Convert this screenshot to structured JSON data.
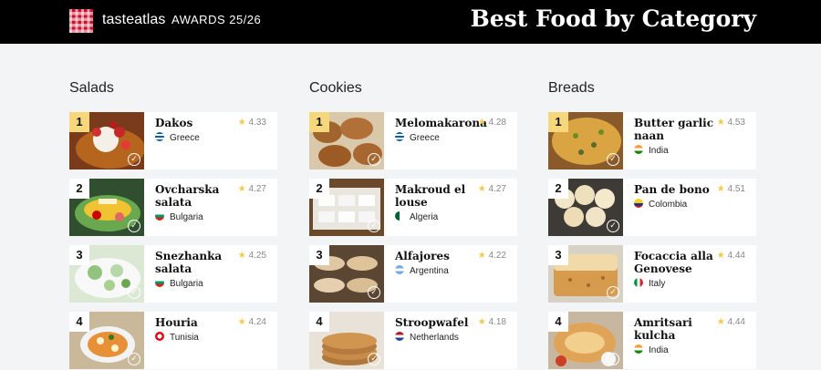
{
  "header": {
    "brand": "tasteatlas",
    "awards": "AWARDS 25/26",
    "title": "Best Food by Category"
  },
  "colors": {
    "accent_gold": "#f6d77b",
    "star": "#f2c94c",
    "header_bg": "#000000"
  },
  "columns": [
    {
      "title": "Salads",
      "items": [
        {
          "rank": "1",
          "name": "Dakos",
          "rating": "4.33",
          "country": "Greece"
        },
        {
          "rank": "2",
          "name": "Ovcharska salata",
          "rating": "4.27",
          "country": "Bulgaria"
        },
        {
          "rank": "3",
          "name": "Snezhanka salata",
          "rating": "4.25",
          "country": "Bulgaria"
        },
        {
          "rank": "4",
          "name": "Houria",
          "rating": "4.24",
          "country": "Tunisia"
        }
      ]
    },
    {
      "title": "Cookies",
      "items": [
        {
          "rank": "1",
          "name": "Melomakarona",
          "rating": "4.28",
          "country": "Greece"
        },
        {
          "rank": "2",
          "name": "Makroud el louse",
          "rating": "4.27",
          "country": "Algeria"
        },
        {
          "rank": "3",
          "name": "Alfajores",
          "rating": "4.22",
          "country": "Argentina"
        },
        {
          "rank": "4",
          "name": "Stroopwafel",
          "rating": "4.18",
          "country": "Netherlands"
        }
      ]
    },
    {
      "title": "Breads",
      "items": [
        {
          "rank": "1",
          "name": "Butter garlic naan",
          "rating": "4.53",
          "country": "India"
        },
        {
          "rank": "2",
          "name": "Pan de bono",
          "rating": "4.51",
          "country": "Colombia"
        },
        {
          "rank": "3",
          "name": "Focaccia alla Genovese",
          "rating": "4.44",
          "country": "Italy"
        },
        {
          "rank": "4",
          "name": "Amritsari kulcha",
          "rating": "4.44",
          "country": "India"
        }
      ]
    }
  ]
}
